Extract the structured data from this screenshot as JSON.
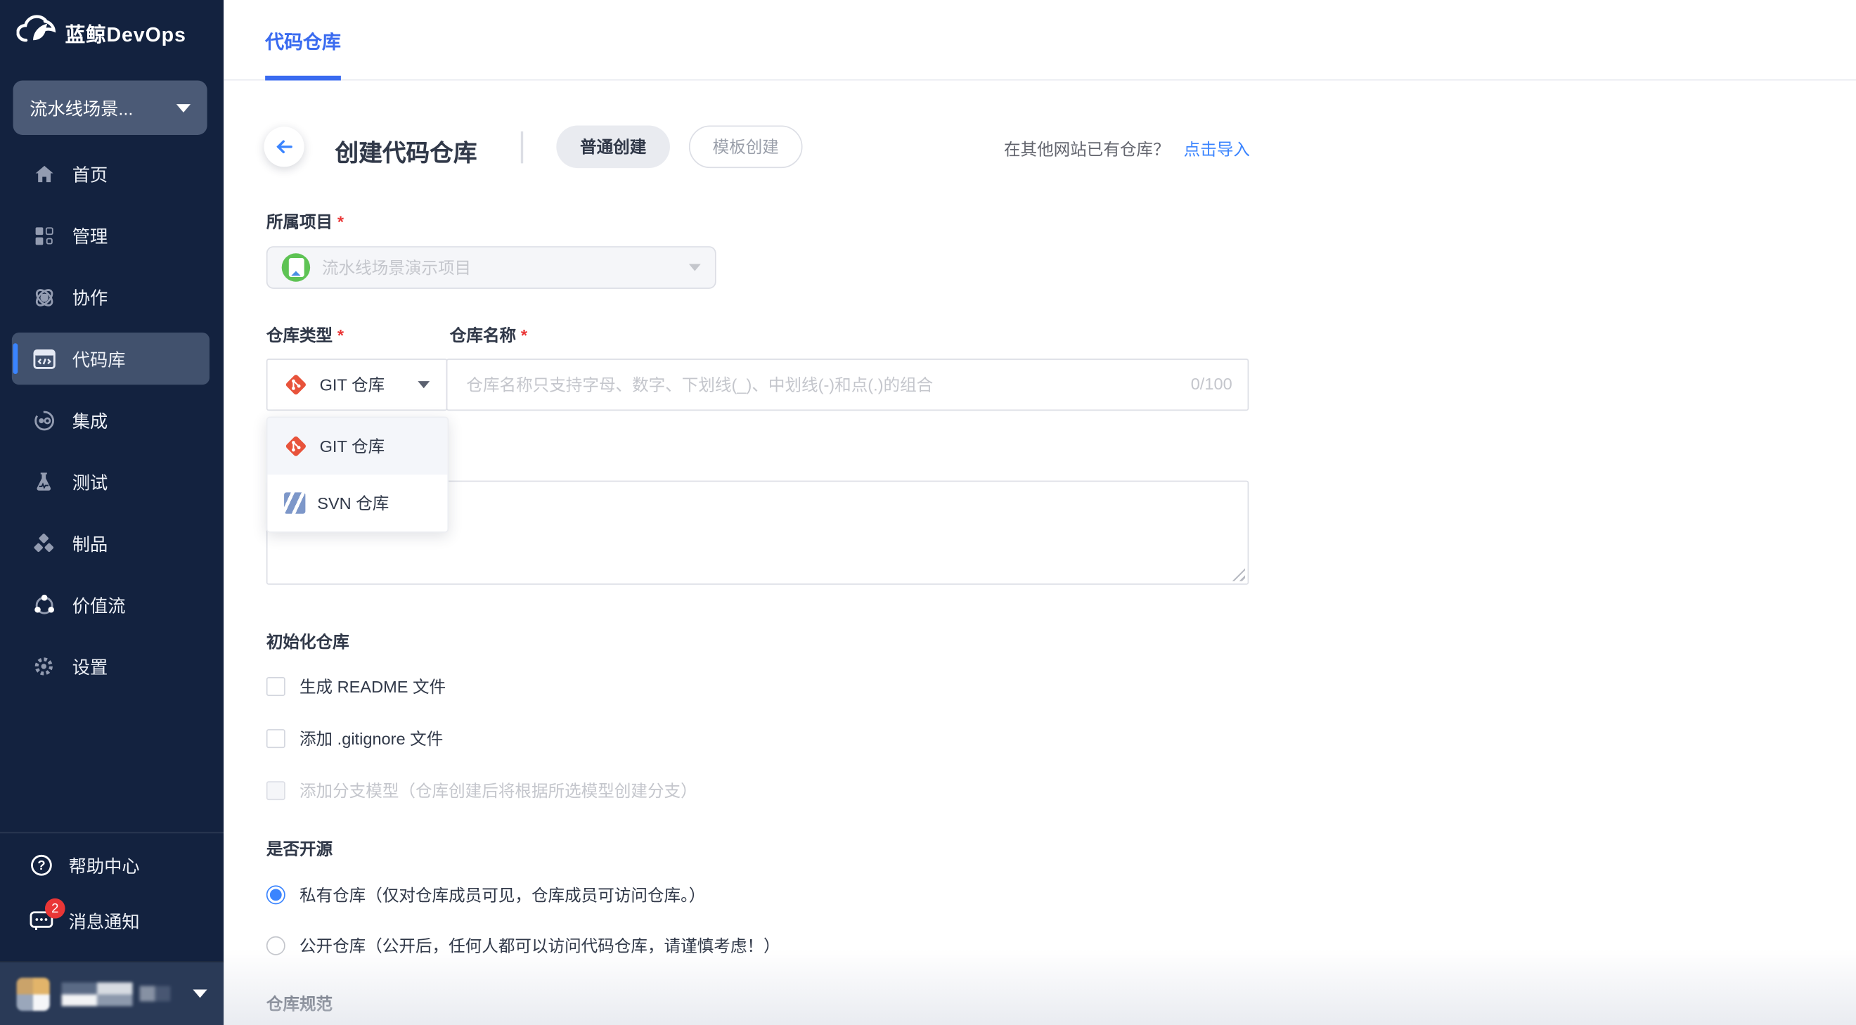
{
  "app": {
    "brand": "蓝鲸DevOps",
    "project_switcher": "流水线场景..."
  },
  "sidebar": {
    "items": [
      {
        "label": "首页",
        "icon": "home-icon",
        "active": false
      },
      {
        "label": "管理",
        "icon": "apps-icon",
        "active": false
      },
      {
        "label": "协作",
        "icon": "collab-icon",
        "active": false
      },
      {
        "label": "代码库",
        "icon": "codelib-icon",
        "active": true
      },
      {
        "label": "集成",
        "icon": "integrate-icon",
        "active": false
      },
      {
        "label": "测试",
        "icon": "test-icon",
        "active": false
      },
      {
        "label": "制品",
        "icon": "artifact-icon",
        "active": false
      },
      {
        "label": "价值流",
        "icon": "value-stream-icon",
        "active": false
      },
      {
        "label": "设置",
        "icon": "settings-icon",
        "active": false
      }
    ],
    "help": {
      "label": "帮助中心",
      "icon": "help-icon"
    },
    "notifications": {
      "label": "消息通知",
      "icon": "message-icon",
      "badge": "2"
    }
  },
  "tabs": [
    {
      "label": "代码仓库",
      "active": true
    }
  ],
  "header": {
    "title": "创建代码仓库",
    "mode_normal": "普通创建",
    "mode_template": "模板创建",
    "import_hint": "在其他网站已有仓库？",
    "import_link": "点击导入"
  },
  "form": {
    "project": {
      "label": "所属项目",
      "required": "*",
      "value": "流水线场景演示项目",
      "disabled": true
    },
    "repo_type": {
      "label": "仓库类型",
      "required": "*",
      "value": "GIT 仓库",
      "options": [
        {
          "label": "GIT 仓库",
          "icon": "git-icon",
          "selected": true
        },
        {
          "label": "SVN 仓库",
          "icon": "svn-icon",
          "selected": false
        }
      ]
    },
    "repo_name": {
      "label": "仓库名称",
      "required": "*",
      "value": "",
      "placeholder": "仓库名称只支持字母、数字、下划线(_)、中划线(-)和点(.)的组合",
      "counter": "0/100"
    },
    "description": {
      "value": ""
    },
    "init_section": {
      "label": "初始化仓库",
      "checkboxes": [
        {
          "label": "生成 README 文件",
          "checked": false,
          "disabled": false
        },
        {
          "label": "添加 .gitignore 文件",
          "checked": false,
          "disabled": false
        },
        {
          "label": "添加分支模型（仓库创建后将根据所选模型创建分支）",
          "checked": false,
          "disabled": true
        }
      ]
    },
    "visibility_section": {
      "label": "是否开源",
      "options": [
        {
          "label": "私有仓库（仅对仓库成员可见，仓库成员可访问仓库。）",
          "selected": true
        },
        {
          "label": "公开仓库（公开后，任何人都可以访问代码仓库，请谨慎考虑！）",
          "selected": false
        }
      ]
    },
    "spec_section": {
      "label": "仓库规范"
    }
  },
  "colors": {
    "sidebar_bg": "#13223f",
    "sidebar_active_bg": "#41516d",
    "primary_blue": "#3a84ff",
    "tab_blue": "#3a6bf0",
    "danger_red": "#ea3636",
    "git_orange": "#e8533b",
    "disabled_bg": "#f5f6f9",
    "border_gray": "#dcdee5",
    "placeholder_gray": "#c4c6cc",
    "text_dark": "#313949"
  }
}
